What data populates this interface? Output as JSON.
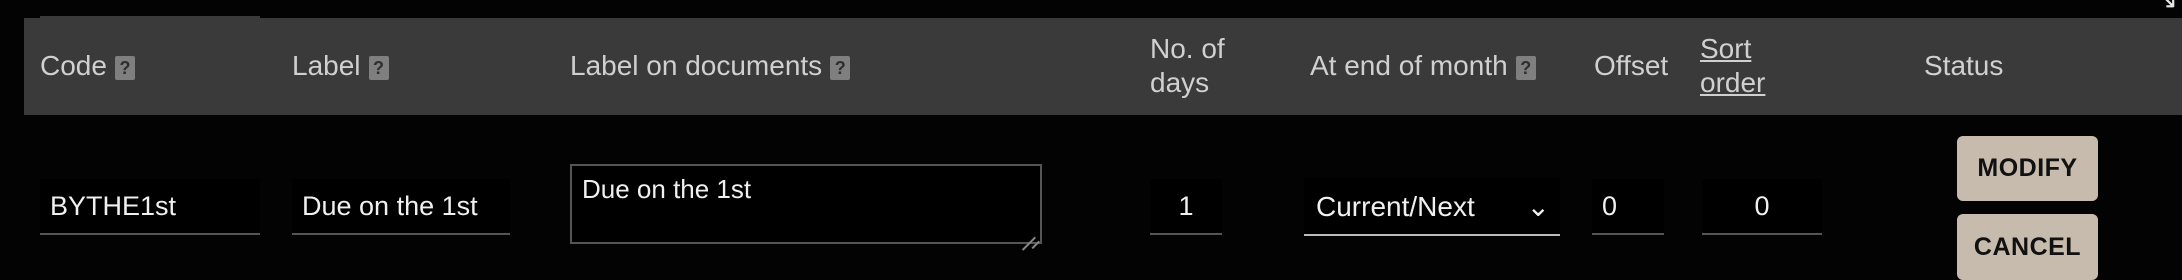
{
  "header": {
    "code": "Code",
    "label": "Label",
    "label_on_documents": "Label on documents",
    "no_of_days_line1": "No. of",
    "no_of_days_line2": "days",
    "at_end_of_month": "At end of month",
    "offset": "Offset",
    "sort_order_line1": "Sort",
    "sort_order_line2": "order",
    "status": "Status",
    "help_glyph": "?"
  },
  "row": {
    "code": "BYTHE1st",
    "label": "Due on the 1st",
    "label_on_documents": "Due on the 1st",
    "no_of_days": "1",
    "at_end_of_month": "Current/Next",
    "offset": "0",
    "sort_order": "0"
  },
  "buttons": {
    "modify": "MODIFY",
    "cancel": "CANCEL"
  },
  "icons": {
    "help": "question-mark",
    "dropdown": "chevron-down"
  },
  "colors": {
    "header_bg": "#3a3a3a",
    "page_bg": "#030303",
    "button_bg": "#c6bbad"
  }
}
